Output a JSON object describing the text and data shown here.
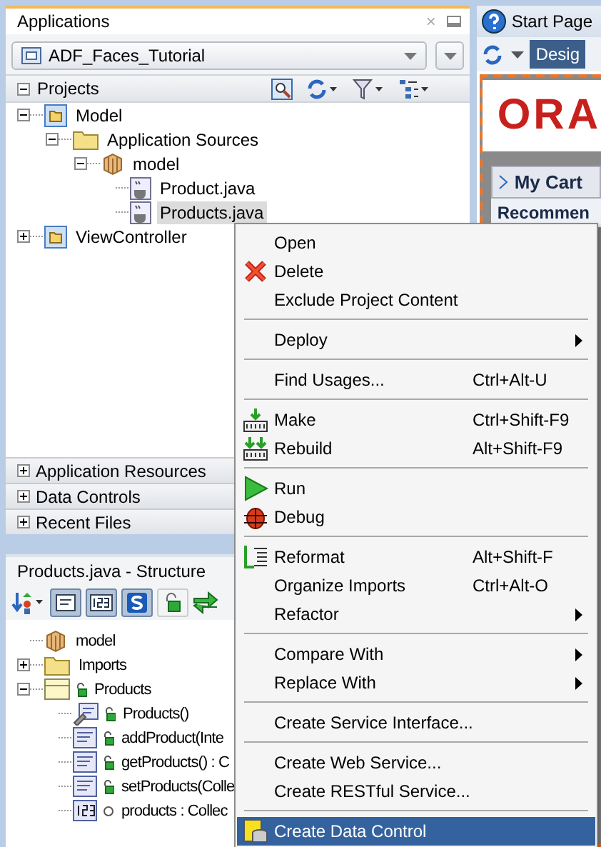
{
  "applications": {
    "title": "Applications",
    "close": "×",
    "app_selector": {
      "value": "ADF_Faces_Tutorial"
    },
    "projects": {
      "title": "Projects",
      "expanded": true,
      "tree": [
        {
          "label": "Model",
          "kind": "project",
          "expanded": true,
          "selected": false,
          "children": [
            {
              "label": "Application Sources",
              "kind": "folder",
              "expanded": true,
              "selected": false,
              "children": [
                {
                  "label": "model",
                  "kind": "package",
                  "expanded": true,
                  "selected": false,
                  "children": [
                    {
                      "label": "Product.java",
                      "kind": "java",
                      "selected": false
                    },
                    {
                      "label": "Products.java",
                      "kind": "java",
                      "selected": true
                    }
                  ]
                }
              ]
            }
          ]
        },
        {
          "label": "ViewController",
          "kind": "project",
          "expanded": false,
          "selected": false
        }
      ]
    },
    "accordion": [
      {
        "label": "Application Resources",
        "expanded": false
      },
      {
        "label": "Data Controls",
        "expanded": false
      },
      {
        "label": "Recent Files",
        "expanded": false
      }
    ]
  },
  "structure": {
    "title": "Products.java - Structure",
    "tree": [
      {
        "label": "model",
        "kind": "package",
        "selected": false
      },
      {
        "label": "Imports",
        "kind": "folder",
        "expanded": false,
        "selected": false
      },
      {
        "label": "Products",
        "kind": "class",
        "expanded": true,
        "selected": false,
        "children": [
          {
            "label": "Products()",
            "kind": "constructor",
            "selected": false
          },
          {
            "label": "addProduct(Inte",
            "kind": "method",
            "selected": false
          },
          {
            "label": "getProducts() : C",
            "kind": "method",
            "selected": false
          },
          {
            "label": "setProducts(Colle",
            "kind": "method",
            "selected": false
          },
          {
            "label": "products : Collec",
            "kind": "field",
            "selected": false
          }
        ]
      }
    ]
  },
  "editor": {
    "tab": "Start Page",
    "mode_button": "Desig",
    "logo": "ORA",
    "cart_title": "My Cart",
    "section_title": "Recommen"
  },
  "context_menu": [
    {
      "kind": "plain",
      "label": "Open",
      "selected": false
    },
    {
      "kind": "delete",
      "label": "Delete",
      "selected": false
    },
    {
      "kind": "plain",
      "label": "Exclude Project Content",
      "selected": false
    },
    {
      "kind": "separator"
    },
    {
      "kind": "plain",
      "label": "Deploy",
      "submenu": true,
      "selected": false
    },
    {
      "kind": "separator"
    },
    {
      "kind": "plain",
      "label": "Find Usages...",
      "shortcut": "Ctrl+Alt-U",
      "selected": false
    },
    {
      "kind": "separator"
    },
    {
      "kind": "make",
      "label": "Make",
      "shortcut": "Ctrl+Shift-F9",
      "selected": false
    },
    {
      "kind": "rebuild",
      "label": "Rebuild",
      "shortcut": "Alt+Shift-F9",
      "selected": false
    },
    {
      "kind": "separator"
    },
    {
      "kind": "run",
      "label": "Run",
      "selected": false
    },
    {
      "kind": "debug",
      "label": "Debug",
      "selected": false
    },
    {
      "kind": "separator"
    },
    {
      "kind": "reformat",
      "label": "Reformat",
      "shortcut": "Alt+Shift-F",
      "selected": false
    },
    {
      "kind": "plain",
      "label": "Organize Imports",
      "shortcut": "Ctrl+Alt-O",
      "selected": false
    },
    {
      "kind": "plain",
      "label": "Refactor",
      "submenu": true,
      "selected": false
    },
    {
      "kind": "separator"
    },
    {
      "kind": "plain",
      "label": "Compare With",
      "submenu": true,
      "selected": false
    },
    {
      "kind": "plain",
      "label": "Replace With",
      "submenu": true,
      "selected": false
    },
    {
      "kind": "separator"
    },
    {
      "kind": "plain",
      "label": "Create Service Interface...",
      "selected": false
    },
    {
      "kind": "separator"
    },
    {
      "kind": "plain",
      "label": "Create Web Service...",
      "selected": false
    },
    {
      "kind": "plain",
      "label": "Create RESTful Service...",
      "selected": false
    },
    {
      "kind": "separator"
    },
    {
      "kind": "datacontrol",
      "label": "Create Data Control",
      "selected": true
    }
  ]
}
